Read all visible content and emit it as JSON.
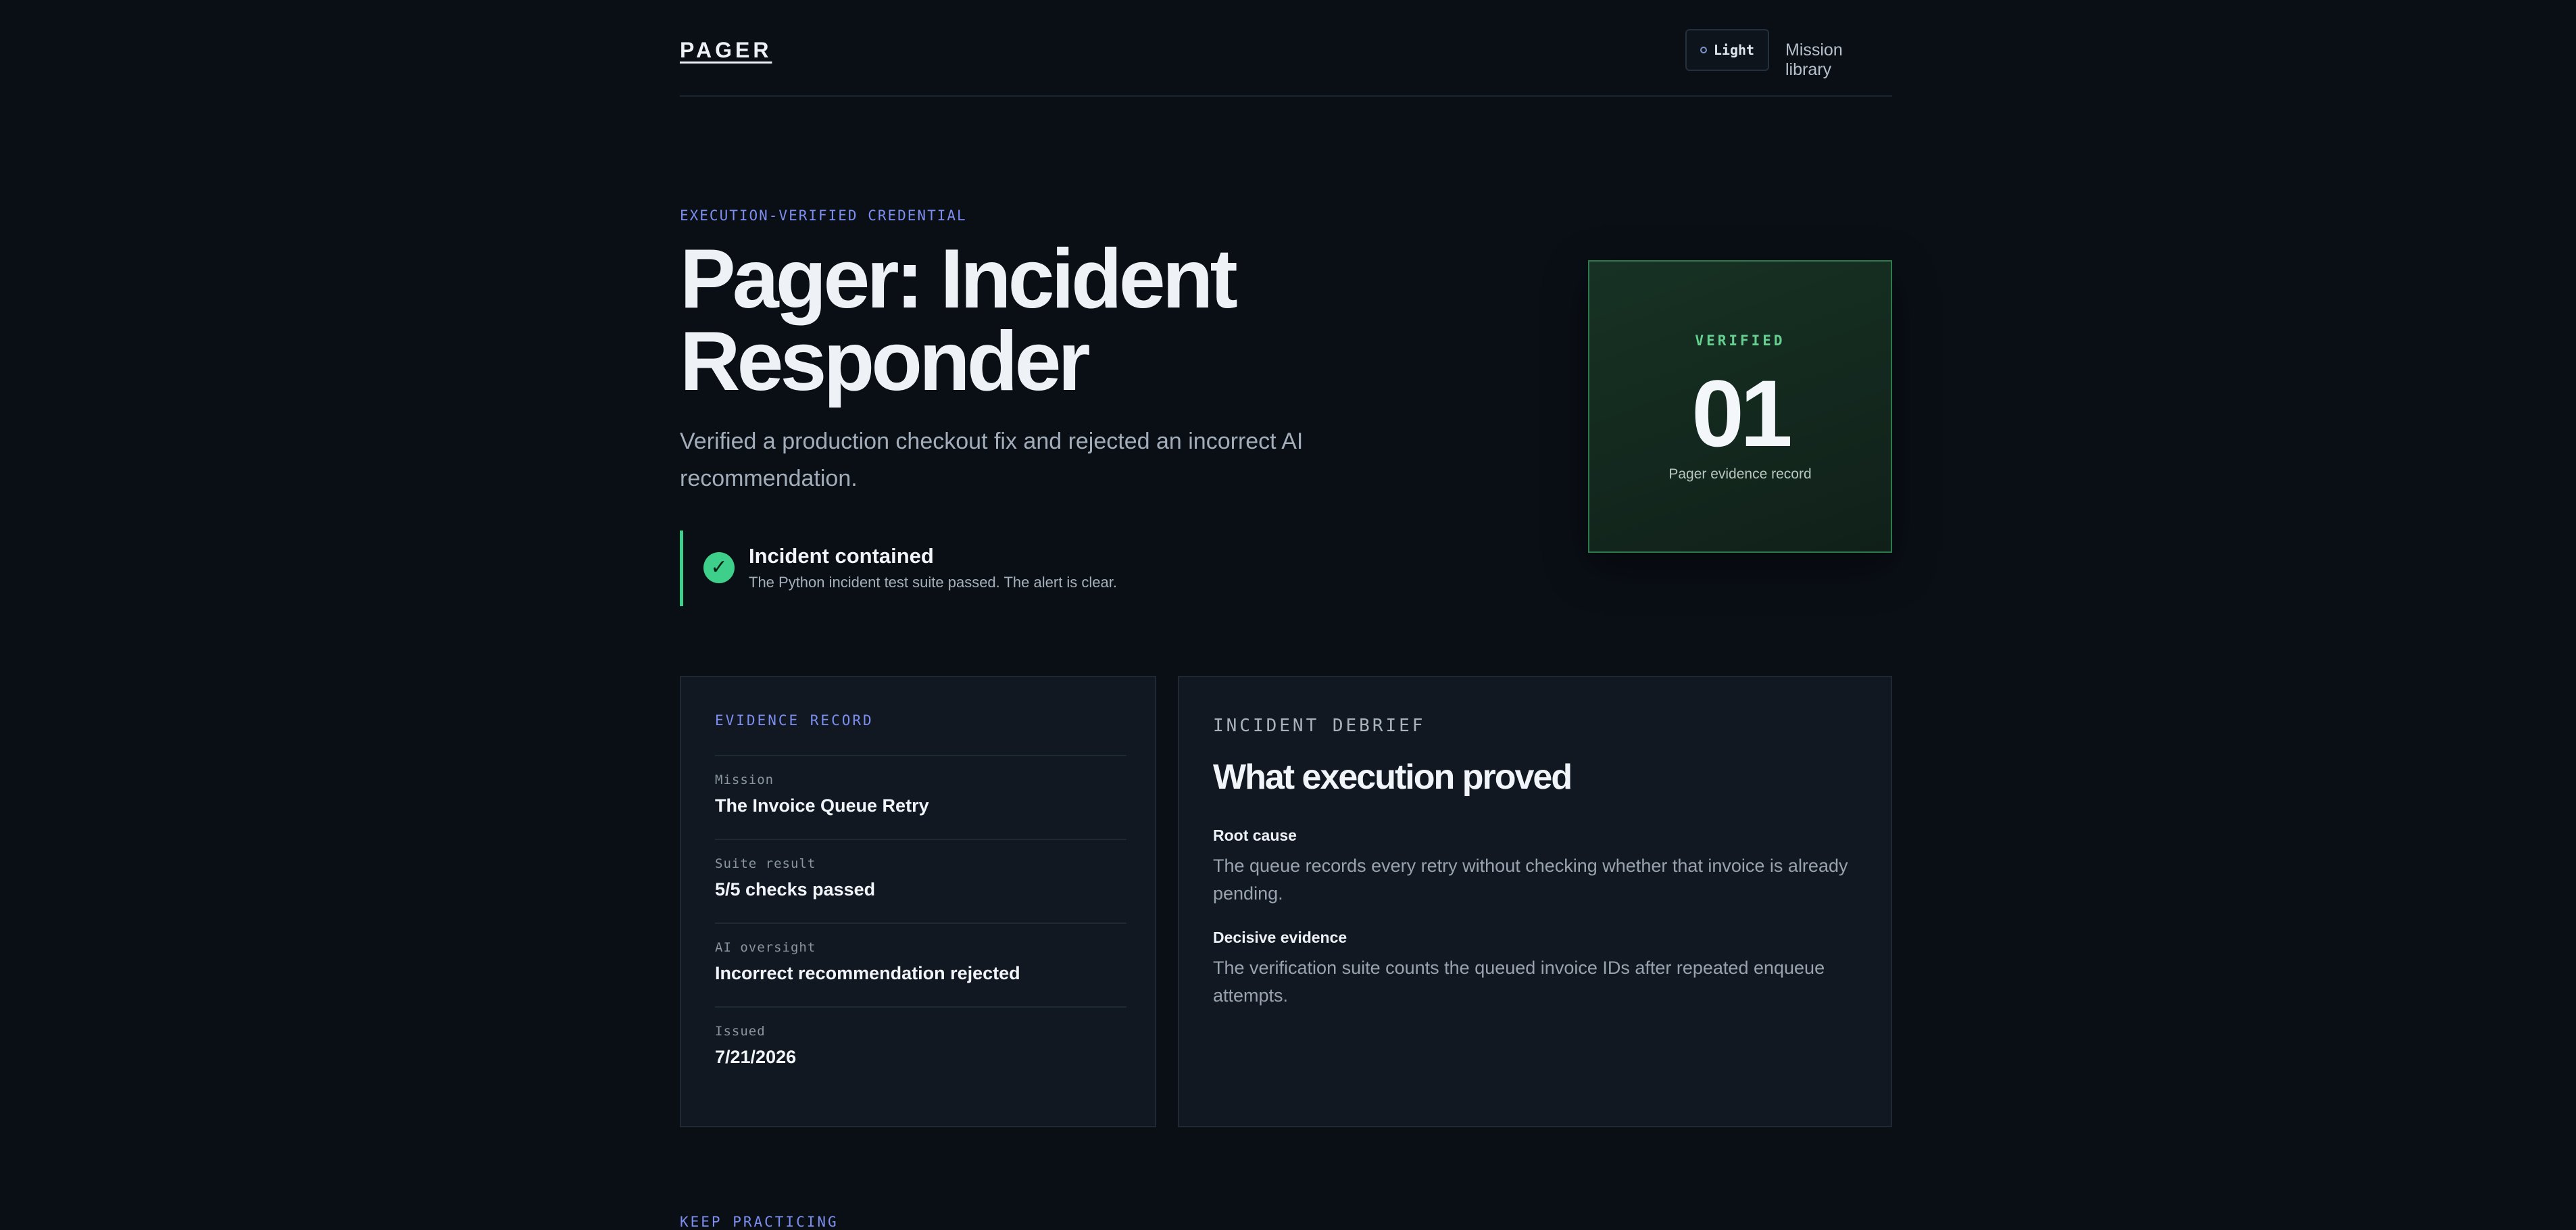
{
  "header": {
    "logo": "PAGER",
    "theme_toggle_label": "Light",
    "nav_link": "Mission library"
  },
  "hero": {
    "eyebrow": "EXECUTION-VERIFIED CREDENTIAL",
    "title_line1": "Pager: Incident",
    "title_line2": "Responder",
    "subtitle": "Verified a production checkout fix and rejected an incorrect AI recommendation.",
    "callout": {
      "icon": "check-icon",
      "title": "Incident contained",
      "description": "The Python incident test suite passed. The alert is clear."
    }
  },
  "badge": {
    "label": "VERIFIED",
    "number": "01",
    "caption": "Pager evidence record"
  },
  "evidence_record": {
    "title": "EVIDENCE RECORD",
    "rows": [
      {
        "label": "Mission",
        "value": "The Invoice Queue Retry"
      },
      {
        "label": "Suite result",
        "value": "5/5 checks passed"
      },
      {
        "label": "AI oversight",
        "value": "Incorrect recommendation rejected"
      },
      {
        "label": "Issued",
        "value": "7/21/2026"
      }
    ]
  },
  "debrief": {
    "eyebrow": "INCIDENT DEBRIEF",
    "title": "What execution proved",
    "sections": [
      {
        "heading": "Root cause",
        "body": "The queue records every retry without checking whether that invoice is already pending."
      },
      {
        "heading": "Decisive evidence",
        "body": "The verification suite counts the queued invoice IDs after repeated enqueue attempts."
      }
    ]
  },
  "footer": {
    "keep_practicing": "KEEP PRACTICING"
  },
  "colors": {
    "background": "#0a0f16",
    "accent": "#7c8ef0",
    "success": "#3ed08a",
    "card": "#111821"
  }
}
